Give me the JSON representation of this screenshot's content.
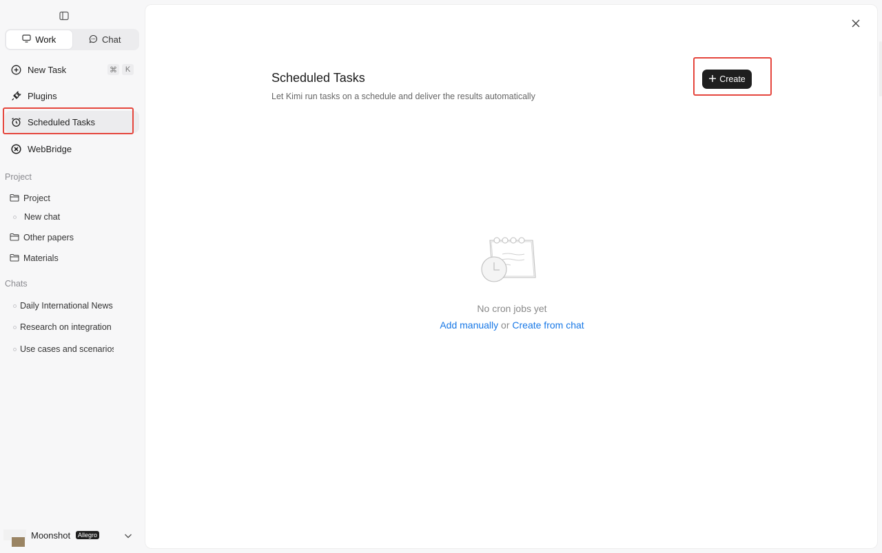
{
  "sidebar": {
    "modes": [
      {
        "label": "Work",
        "active": true
      },
      {
        "label": "Chat",
        "active": false
      }
    ],
    "nav": {
      "new_task": "New Task",
      "shortcut_cmd": "⌘",
      "shortcut_key": "K",
      "plugins": "Plugins",
      "scheduled_tasks": "Scheduled Tasks",
      "webbridge": "WebBridge"
    },
    "project_section": "Project",
    "projects": {
      "project": "Project",
      "new_chat": "New chat",
      "other_papers": "Other papers",
      "materials": "Materials"
    },
    "chats_section": "Chats",
    "chats": [
      "Daily International News",
      "Research on integration",
      "Use cases and scenarios"
    ],
    "user": {
      "name": "Moonshot",
      "badge": "Allegro"
    }
  },
  "main": {
    "title": "Scheduled Tasks",
    "subtitle": "Let Kimi run tasks on a schedule and deliver the results automatically",
    "create_label": "Create",
    "empty": {
      "message": "No cron jobs yet",
      "add_manually": "Add manually",
      "or": " or ",
      "create_from_chat": "Create from chat"
    }
  },
  "colors": {
    "accent_link": "#1677e6",
    "highlight": "#e5453c",
    "primary_button": "#1f1f1f"
  }
}
